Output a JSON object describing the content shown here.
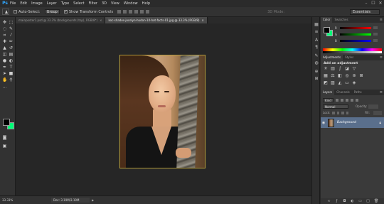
{
  "app": {
    "logo": "Ps"
  },
  "menu": [
    "File",
    "Edit",
    "Image",
    "Layer",
    "Type",
    "Select",
    "Filter",
    "3D",
    "View",
    "Window",
    "Help"
  ],
  "window_controls": [
    "–",
    "☐",
    "✕"
  ],
  "options": {
    "auto_select_label": "Auto-Select:",
    "auto_select_value": "Group",
    "show_transform_label": "Show Transform Controls",
    "mode_3d_label": "3D Mode:",
    "workspace": "Essentials"
  },
  "tabs": [
    {
      "label": "mainposter1.psd @ 33.3% (backgrounds (top), RGB/8*)",
      "close": "×"
    },
    {
      "label": "koc-shades-jocelyn-hudon-10-hot-facts-01.jpg @ 33.3% (RGB/8)",
      "close": "×"
    }
  ],
  "status": {
    "zoom": "33.33%",
    "doc_info": "Doc: 3.19M/3.19M",
    "arrow": "▶"
  },
  "panels": {
    "color_tabs": [
      "Color",
      "Swatches"
    ],
    "sliders": [
      {
        "label": "R",
        "gradient": "linear-gradient(90deg,#000,#ff0000)"
      },
      {
        "label": "G",
        "gradient": "linear-gradient(90deg,#000,#00ff00)"
      },
      {
        "label": "B",
        "gradient": "linear-gradient(90deg,#000,#0000ff)"
      }
    ],
    "adjustment_tabs": [
      "Adjustments",
      "Styles"
    ],
    "adjustment_title": "Add an adjustment",
    "layers_tabs": [
      "Layers",
      "Channels",
      "Paths"
    ],
    "kind_label": "Kind",
    "blend_mode": "Normal",
    "opacity_label": "Opacity:",
    "lock_label": "Lock:",
    "fill_label": "Fill:",
    "layer_name": "Background"
  },
  "colors": {
    "foreground": "#000000",
    "background": "#00ff78",
    "selected_layer": "#5a6f8c"
  }
}
